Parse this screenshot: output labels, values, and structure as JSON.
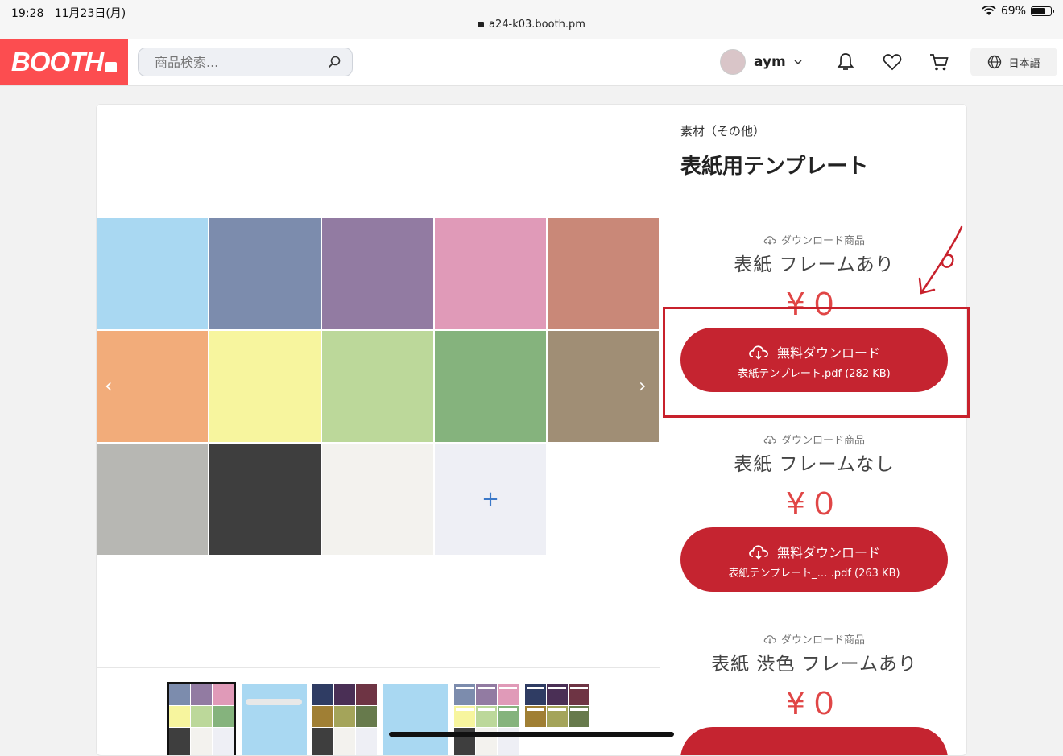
{
  "statusbar": {
    "time": "19:28",
    "date": "11月23日(月)",
    "url": "a24-k03.booth.pm",
    "battery": "69%"
  },
  "header": {
    "logo": "BOOTH",
    "search_placeholder": "商品検索...",
    "username": "aym",
    "language": "日本語"
  },
  "product": {
    "category": "素材（その他）",
    "title": "表紙用テンプレート"
  },
  "variants": [
    {
      "tag": "ダウンロード商品",
      "name": "表紙 フレームあり",
      "price": "¥０",
      "button_label": "無料ダウンロード",
      "file": "表紙テンプレート.pdf (282 KB)"
    },
    {
      "tag": "ダウンロード商品",
      "name": "表紙 フレームなし",
      "price": "¥０",
      "button_label": "無料ダウンロード",
      "file": "表紙テンプレート_…  .pdf (263 KB)"
    },
    {
      "tag": "ダウンロード商品",
      "name": "表紙 渋色 フレームあり",
      "price": "¥０"
    }
  ],
  "swatches": [
    "#a9d8f2",
    "#7c8cad",
    "#927ba2",
    "#e09ab8",
    "#c98878",
    "#f2ac7a",
    "#f7f59e",
    "#bcd89a",
    "#85b37d",
    "#a08e75",
    "#b7b7b3",
    "#3e3e3e",
    "#f3f2ee"
  ],
  "accent": "#c52430",
  "brand": "#fc4d50"
}
